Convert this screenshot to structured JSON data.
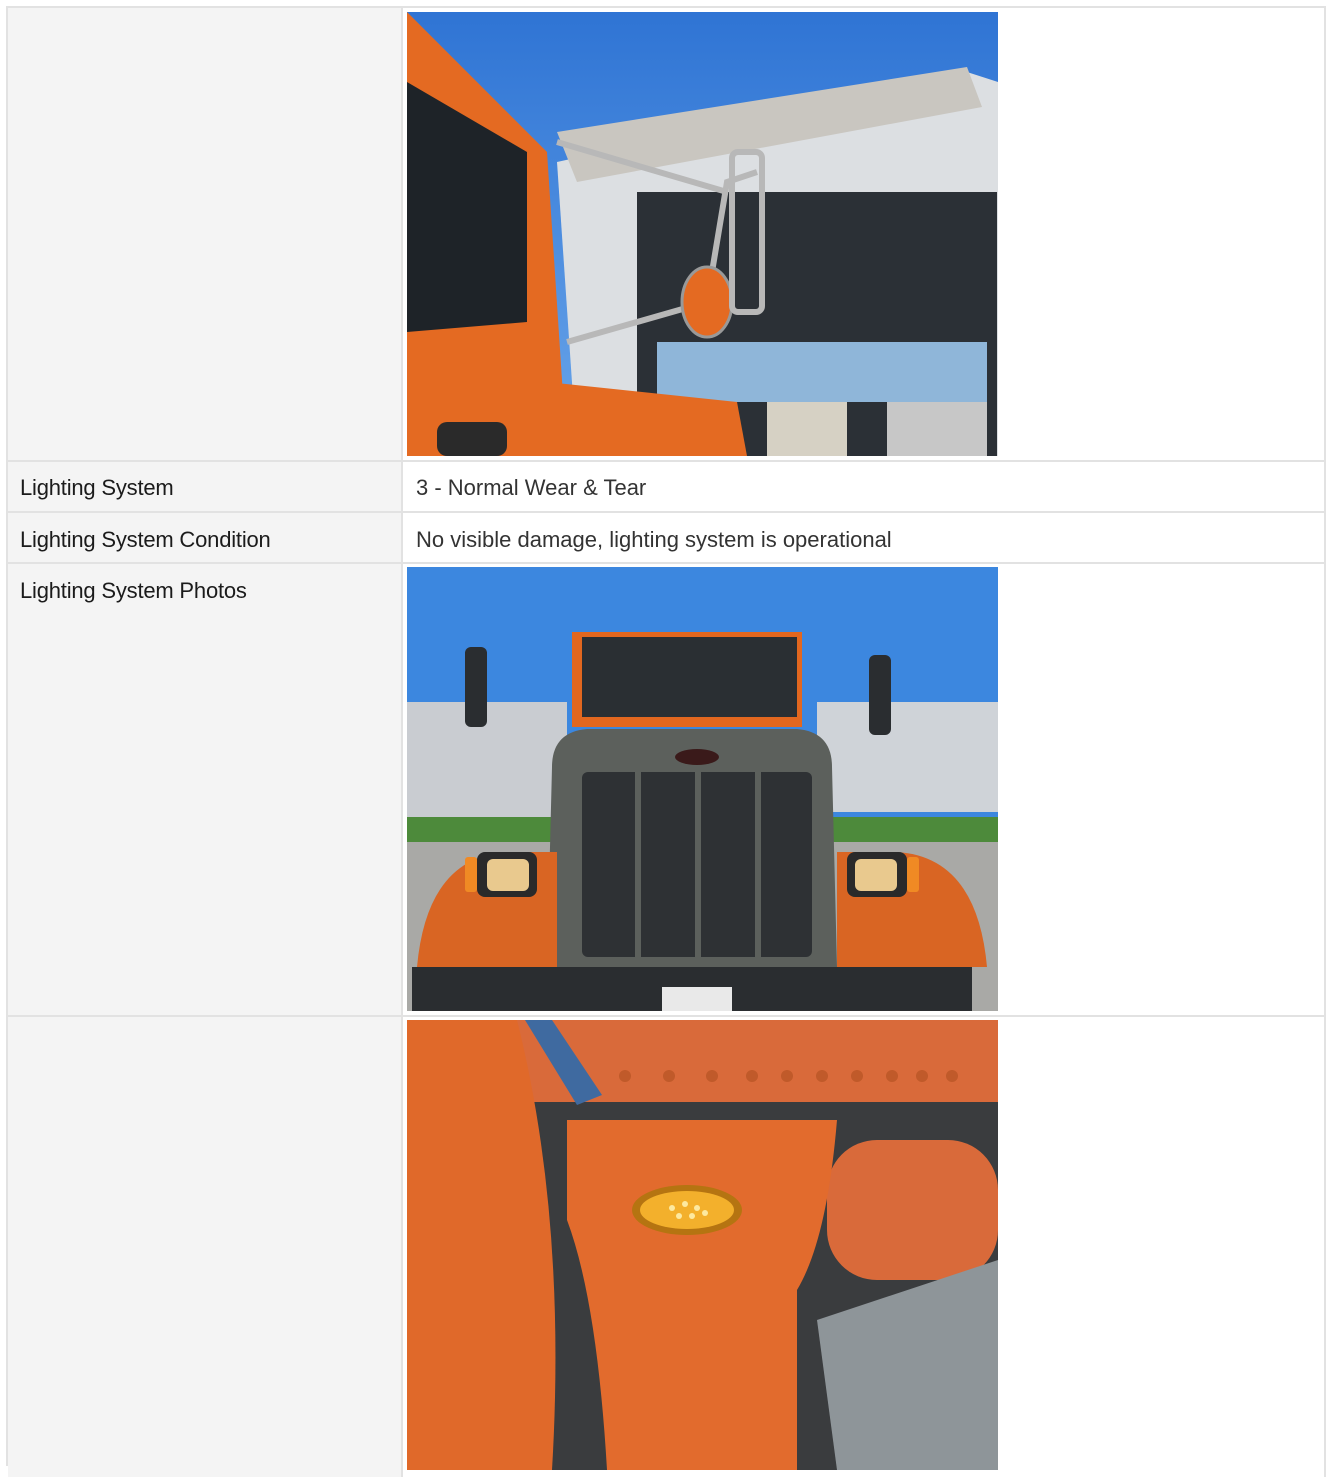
{
  "rows": [
    {
      "label": "",
      "value": "",
      "photo": "truck-mirror-photo"
    },
    {
      "label": "Lighting System",
      "value": "3 - Normal Wear & Tear"
    },
    {
      "label": "Lighting System Condition",
      "value": "No visible damage, lighting system is operational"
    },
    {
      "label": "Lighting System Photos",
      "value": "",
      "photo": "truck-front-headlights-photo"
    },
    {
      "label": "",
      "value": "",
      "photo": "truck-side-marker-light-photo"
    }
  ],
  "colors": {
    "label_bg": "#f4f4f4",
    "border": "#e2e2e2",
    "truck_orange": "#e0692a",
    "sky": "#3b7fd6"
  }
}
